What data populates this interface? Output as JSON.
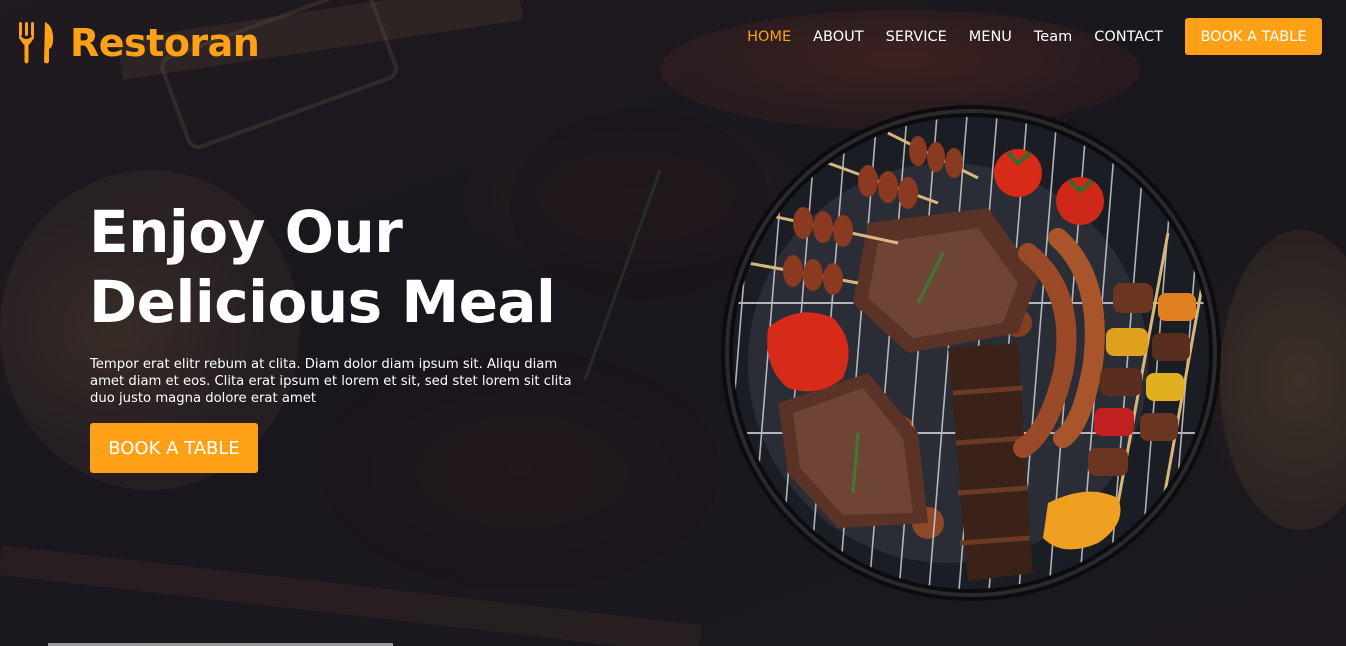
{
  "brand": {
    "name": "Restoran",
    "icon": "utensils-icon",
    "color": "#FEA116"
  },
  "nav": {
    "items": [
      {
        "label": "HOME",
        "active": true
      },
      {
        "label": "ABOUT"
      },
      {
        "label": "SERVICE"
      },
      {
        "label": "MENU"
      },
      {
        "label": "Team"
      },
      {
        "label": "CONTACT"
      }
    ],
    "book_label": "BOOK A TABLE"
  },
  "hero": {
    "title_line1": "Enjoy Our",
    "title_line2": "Delicious Meal",
    "description": "Tempor erat elitr rebum at clita. Diam dolor diam ipsum sit. Aliqu diam amet diam et eos. Clita erat ipsum et lorem et sit, sed stet lorem sit clita duo justo magna dolore erat amet",
    "button_label": "BOOK A TABLE"
  },
  "colors": {
    "accent": "#FEA116",
    "dark_overlay": "#0F172B"
  }
}
